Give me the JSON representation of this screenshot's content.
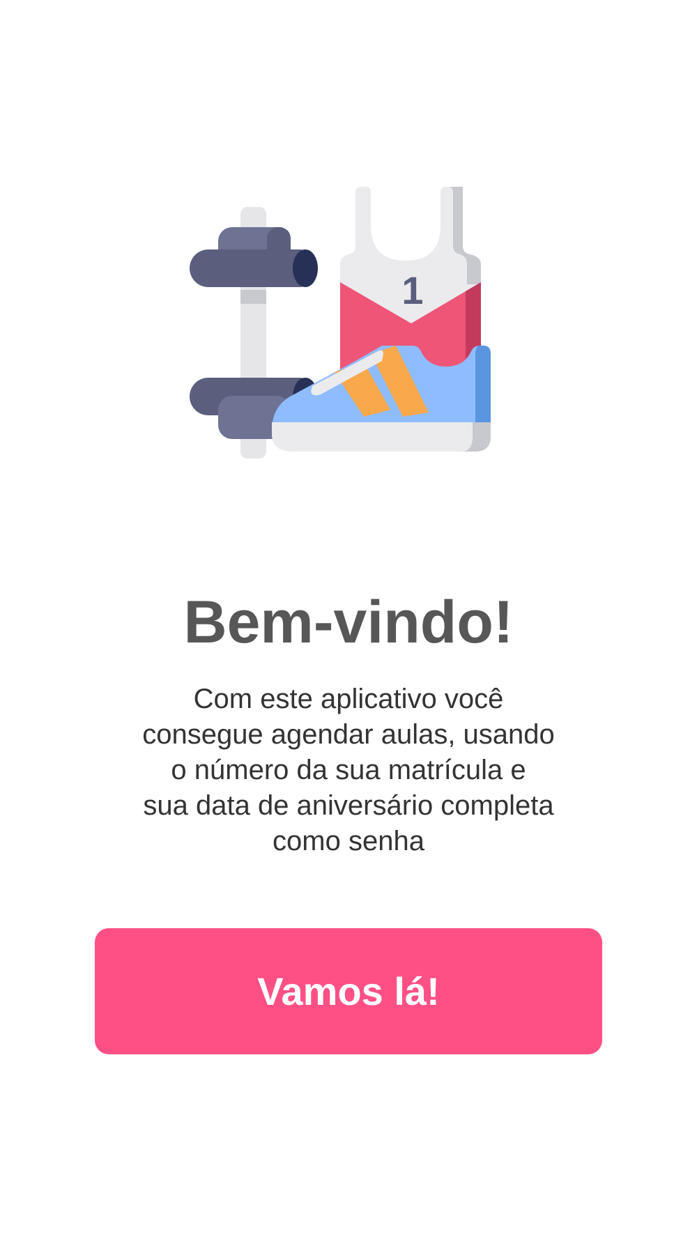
{
  "illustration": {
    "icon": "gym-equipment-icon",
    "jersey_number": "1",
    "colors": {
      "dumbbell": "#5b5f7d",
      "dumbbell_dark": "#273056",
      "dumbbell_light": "#6e7394",
      "bar": "#e6e6e9",
      "jersey": "#ebebee",
      "jersey_red": "#ee5577",
      "jersey_red_dark": "#c43a5d",
      "shoe_blue": "#8fbcff",
      "shoe_blue_dark": "#5a95e0",
      "shoe_stripe": "#f9a84b"
    }
  },
  "welcome": {
    "title": "Bem-vindo!",
    "description_lines": [
      "Com este aplicativo você",
      "consegue agendar aulas, usando",
      "o número da sua matrícula e",
      "sua data de aniversário completa",
      "como senha"
    ]
  },
  "actions": {
    "start_label": "Vamos lá!"
  },
  "theme": {
    "accent": "#ff5085",
    "title_color": "#575757",
    "text_color": "#333333",
    "background": "#ffffff"
  }
}
